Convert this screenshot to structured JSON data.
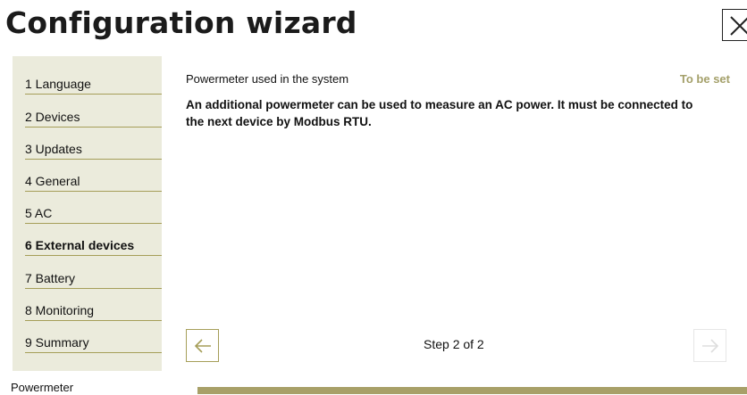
{
  "header": {
    "title": "Configuration wizard"
  },
  "sidebar": {
    "steps": [
      {
        "label": "1 Language",
        "active": false
      },
      {
        "label": "2 Devices",
        "active": false
      },
      {
        "label": "3 Updates",
        "active": false
      },
      {
        "label": "4 General",
        "active": false
      },
      {
        "label": "5 AC",
        "active": false
      },
      {
        "label": "6 External devices",
        "active": true
      },
      {
        "label": "7 Battery",
        "active": false
      },
      {
        "label": "8 Monitoring",
        "active": false
      },
      {
        "label": "9 Summary",
        "active": false
      }
    ]
  },
  "main": {
    "section_label": "Powermeter used in the system",
    "status": "To be set",
    "description": "An additional powermeter can be used to measure an AC power. It must be connected to the next device by Modbus RTU.",
    "step_counter": "Step 2 of 2"
  },
  "footer": {
    "label": "Powermeter",
    "progress_fraction": 1.0
  },
  "colors": {
    "accent": "#a8a068",
    "sidebar_bg": "#ebebdc",
    "status_text": "#a4a06a"
  },
  "icons": {
    "close": "close-icon",
    "prev": "arrow-left-icon",
    "next": "arrow-right-icon"
  }
}
